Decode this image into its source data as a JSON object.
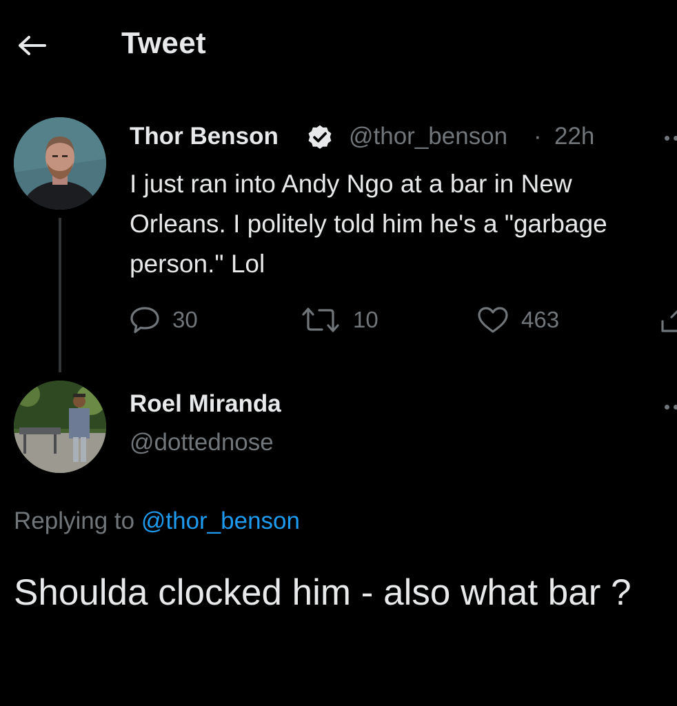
{
  "header": {
    "title": "Tweet",
    "back_icon": "arrow-left-icon"
  },
  "original_tweet": {
    "author_name": "Thor Benson",
    "verified": true,
    "handle": "@thor_benson",
    "separator": "·",
    "time": "22h",
    "text": "I just ran into Andy Ngo at a bar in New Orleans. I politely told him he's a \"garbage person.\" Lol",
    "actions": {
      "replies": "30",
      "retweets": "10",
      "likes": "463"
    }
  },
  "reply_tweet": {
    "author_name": "Roel Miranda",
    "handle": "@dottednose",
    "replying_prefix": "Replying to",
    "replying_to": "@thor_benson",
    "text": "Shoulda clocked him - also what bar ?"
  },
  "colors": {
    "background": "#000000",
    "text_primary": "#e7e9ea",
    "text_secondary": "#71767b",
    "accent": "#1d9bf0",
    "thread_line": "#333639"
  }
}
